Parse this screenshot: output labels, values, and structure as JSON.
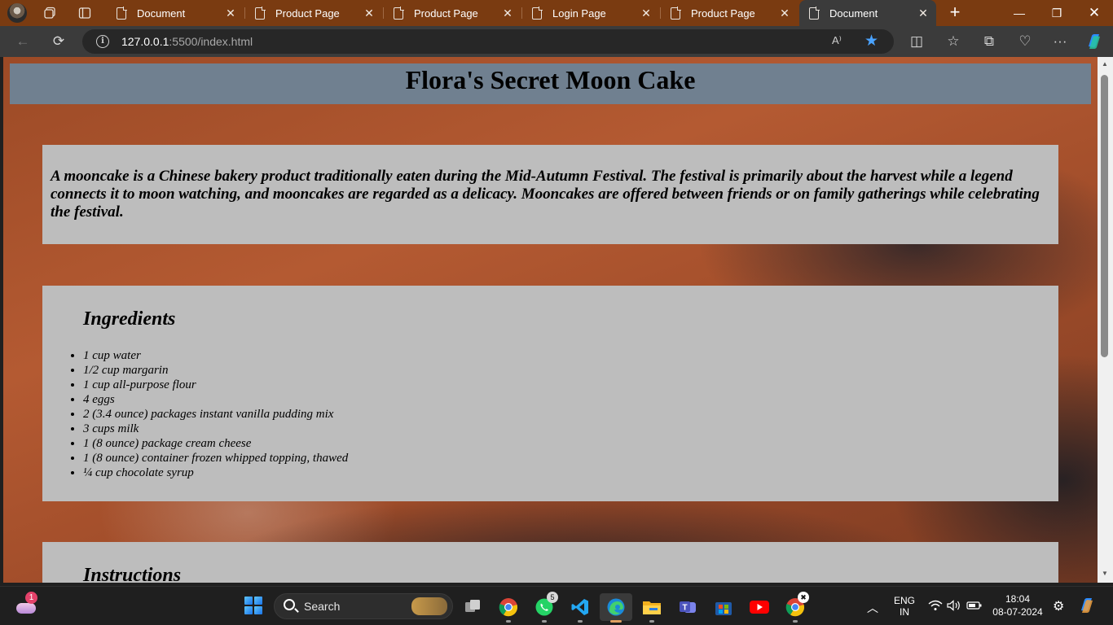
{
  "browser": {
    "tabs": [
      {
        "title": "Document",
        "active": false
      },
      {
        "title": "Product Page",
        "active": false
      },
      {
        "title": "Product Page",
        "active": false
      },
      {
        "title": "Login Page",
        "active": false
      },
      {
        "title": "Product Page",
        "active": false
      },
      {
        "title": "Document",
        "active": true
      }
    ],
    "url_host": "127.0.0.1",
    "url_rest": ":5500/index.html",
    "icons": {
      "back": "←",
      "refresh": "⟳",
      "read_aloud": "A⁾",
      "favorite": "★",
      "split": "◫",
      "favorites": "☆",
      "collections": "⧉",
      "health": "♡",
      "more": "···",
      "close": "✕",
      "new_tab": "+",
      "minimize": "—",
      "restore": "❐",
      "win_close": "✕"
    }
  },
  "page": {
    "title": "Flora's Secret Moon Cake",
    "intro": "A mooncake is a Chinese bakery product traditionally eaten during the Mid-Autumn Festival. The festival is primarily about the harvest while a legend connects it to moon watching, and mooncakes are regarded as a delicacy. Mooncakes are offered between friends or on family gatherings while celebrating the festival.",
    "ingredients_title": "Ingredients",
    "ingredients": [
      "1 cup water",
      "1/2 cup margarin",
      "1 cup all-purpose flour",
      "4 eggs",
      "2 (3.4 ounce) packages instant vanilla pudding mix",
      "3 cups milk",
      "1 (8 ounce) package cream cheese",
      "1 (8 ounce) container frozen whipped topping, thawed",
      "¼ cup chocolate syrup"
    ],
    "instructions_title": "Instructions"
  },
  "taskbar": {
    "weather_badge": "1",
    "search_label": "Search",
    "whatsapp_badge": "5",
    "lang_top": "ENG",
    "lang_bottom": "IN",
    "time": "18:04",
    "date": "08-07-2024",
    "colors": {
      "accent": "#e0a060",
      "start": "#1a73e8"
    }
  }
}
